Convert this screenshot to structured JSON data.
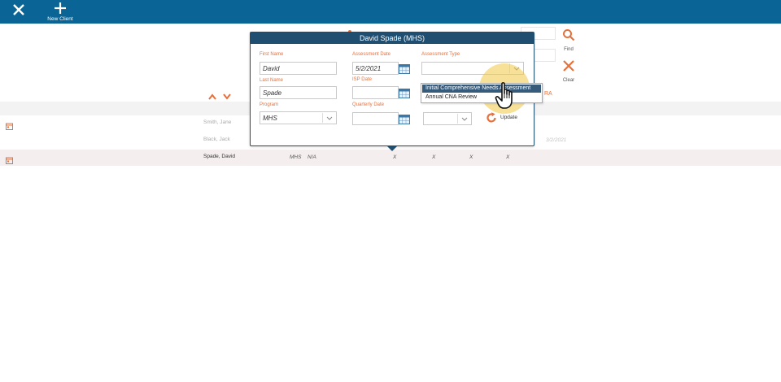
{
  "topbar": {
    "new_client_label": "New Client"
  },
  "side_actions": {
    "find_label": "Find",
    "clear_label": "Clear"
  },
  "column_header_ra": "RA",
  "rows": [
    {
      "name": "Smith, Jane",
      "faint": true
    },
    {
      "name": "Black, Jack",
      "faint": true,
      "cell_date": "3/2/2021"
    },
    {
      "name": "Spade, David",
      "faint": false,
      "program": "MHS",
      "isp": "N/A",
      "col1": "X",
      "col2": "X",
      "col3": "X",
      "col4": "X"
    }
  ],
  "modal": {
    "title": "David Spade (MHS)",
    "first_name_label": "First Name",
    "first_name_value": "David",
    "last_name_label": "Last Name",
    "last_name_value": "Spade",
    "program_label": "Program",
    "program_value": "MHS",
    "assessment_date_label": "Assessment Date",
    "assessment_date_value": "5/2/2021",
    "isp_date_label": "ISP Date",
    "isp_date_value": "",
    "quarterly_date_label": "Quarterly  Date",
    "quarterly_date_value": "",
    "assessment_type_label": "Assessment Type",
    "assessment_type_value": "",
    "assessment_type_options": [
      "Initial Comprehensive Needs Assessment",
      "Annual CNA Review"
    ],
    "update_label": "Update"
  },
  "colors": {
    "topbar": "#0a6496",
    "accent_orange": "#e8703a",
    "modal_header": "#1f4e70",
    "dropdown_selected": "#375b7b"
  }
}
